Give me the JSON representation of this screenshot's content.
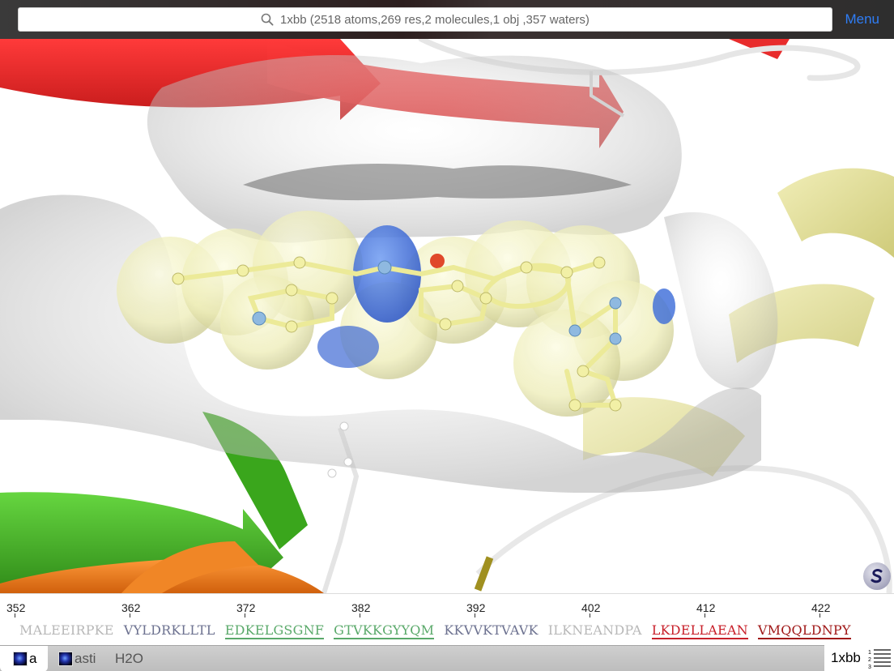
{
  "search": {
    "text": "1xbb (2518 atoms,269 res,2 molecules,1 obj ,357 waters)"
  },
  "menu_label": "Menu",
  "ruler": {
    "ticks": [
      "352",
      "362",
      "372",
      "382",
      "392",
      "402",
      "412",
      "422"
    ]
  },
  "sequence": {
    "segments": [
      {
        "text": "MALEEIRPKE",
        "color": "#b8b8b8",
        "underline": false
      },
      {
        "text": "VYLDRKLLTL",
        "color": "#6d7290",
        "underline": false
      },
      {
        "text": "EDKELGSGNF",
        "color": "#5aa96a",
        "underline": true
      },
      {
        "text": "GTVKKGYYQM",
        "color": "#5aa96a",
        "underline": true
      },
      {
        "text": "KKVVKTVAVK",
        "color": "#6d7290",
        "underline": false
      },
      {
        "text": "ILKNEANDPA",
        "color": "#b8b8b8",
        "underline": false
      },
      {
        "text": "LKDELLAEAN",
        "color": "#c8202a",
        "underline": true
      },
      {
        "text": "VMQQLDNPY",
        "color": "#a01818",
        "underline": true
      }
    ]
  },
  "tabs": [
    {
      "label": "a",
      "icon": "molecule-render-icon",
      "active": true
    },
    {
      "label": "asti",
      "icon": "molecule-render-icon",
      "active": false
    },
    {
      "label": "H2O",
      "icon": "",
      "active": false
    }
  ],
  "pdb_tab": {
    "label": "1xbb",
    "icon": "numbered-list-icon"
  },
  "colors": {
    "accent": "#2f7df6",
    "ligand": "#f4f0a8",
    "nitrogen": "#3a6fe0",
    "oxygen": "#e0482a",
    "sheet_red": "#e8242c",
    "sheet_green": "#4cbc2a",
    "helix_orange": "#f07a1a",
    "helix_yellow": "#e6e29a"
  }
}
